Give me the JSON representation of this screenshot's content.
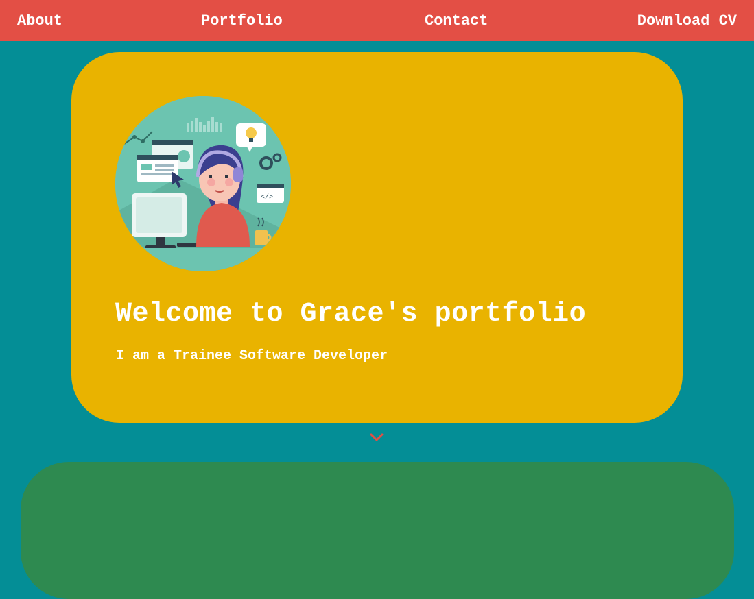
{
  "nav": {
    "about": "About",
    "portfolio": "Portfolio",
    "contact": "Contact",
    "download_cv": "Download CV"
  },
  "hero": {
    "title": "Welcome to Grace's portfolio",
    "subtitle": "I am a Trainee Software Developer"
  },
  "icons": {
    "scroll_down": "chevron-down-icon"
  },
  "colors": {
    "page_background": "#048e96",
    "navbar": "#e34f45",
    "hero_card": "#e9b300",
    "next_section": "#2e8a50",
    "text": "#ffffff",
    "accent_arrow": "#e34f45"
  }
}
